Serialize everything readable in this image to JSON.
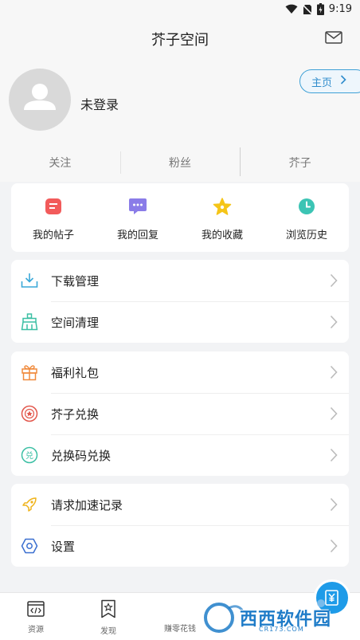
{
  "status": {
    "time": "9:19"
  },
  "header": {
    "title": "芥子空间"
  },
  "profile": {
    "login_text": "未登录",
    "home_button": "主页"
  },
  "stats": [
    "关注",
    "粉丝",
    "芥子"
  ],
  "quick_links": [
    {
      "label": "我的帖子",
      "icon": "post-icon",
      "color": "#f25b5b"
    },
    {
      "label": "我的回复",
      "icon": "reply-icon",
      "color": "#8a7ce8"
    },
    {
      "label": "我的收藏",
      "icon": "star-icon",
      "color": "#f5c518"
    },
    {
      "label": "浏览历史",
      "icon": "clock-icon",
      "color": "#3cc4b4"
    }
  ],
  "menu_groups": [
    [
      {
        "label": "下载管理",
        "icon": "download-icon"
      },
      {
        "label": "空间清理",
        "icon": "broom-icon"
      }
    ],
    [
      {
        "label": "福利礼包",
        "icon": "gift-icon"
      },
      {
        "label": "芥子兑换",
        "icon": "badge-icon"
      },
      {
        "label": "兑换码兑换",
        "icon": "exchange-icon"
      }
    ],
    [
      {
        "label": "请求加速记录",
        "icon": "rocket-icon"
      },
      {
        "label": "设置",
        "icon": "hexagon-settings-icon"
      }
    ]
  ],
  "tabs": [
    {
      "label": "资源",
      "icon": "code-icon"
    },
    {
      "label": "发现",
      "icon": "bookmark-star-icon"
    },
    {
      "label": "赚零花钱",
      "icon": "money-icon"
    }
  ],
  "watermark": {
    "brand": "西西软件园",
    "site": "CR173.COM"
  },
  "colors": {
    "accent": "#1e9be8",
    "home_border": "#3ea0d6"
  }
}
